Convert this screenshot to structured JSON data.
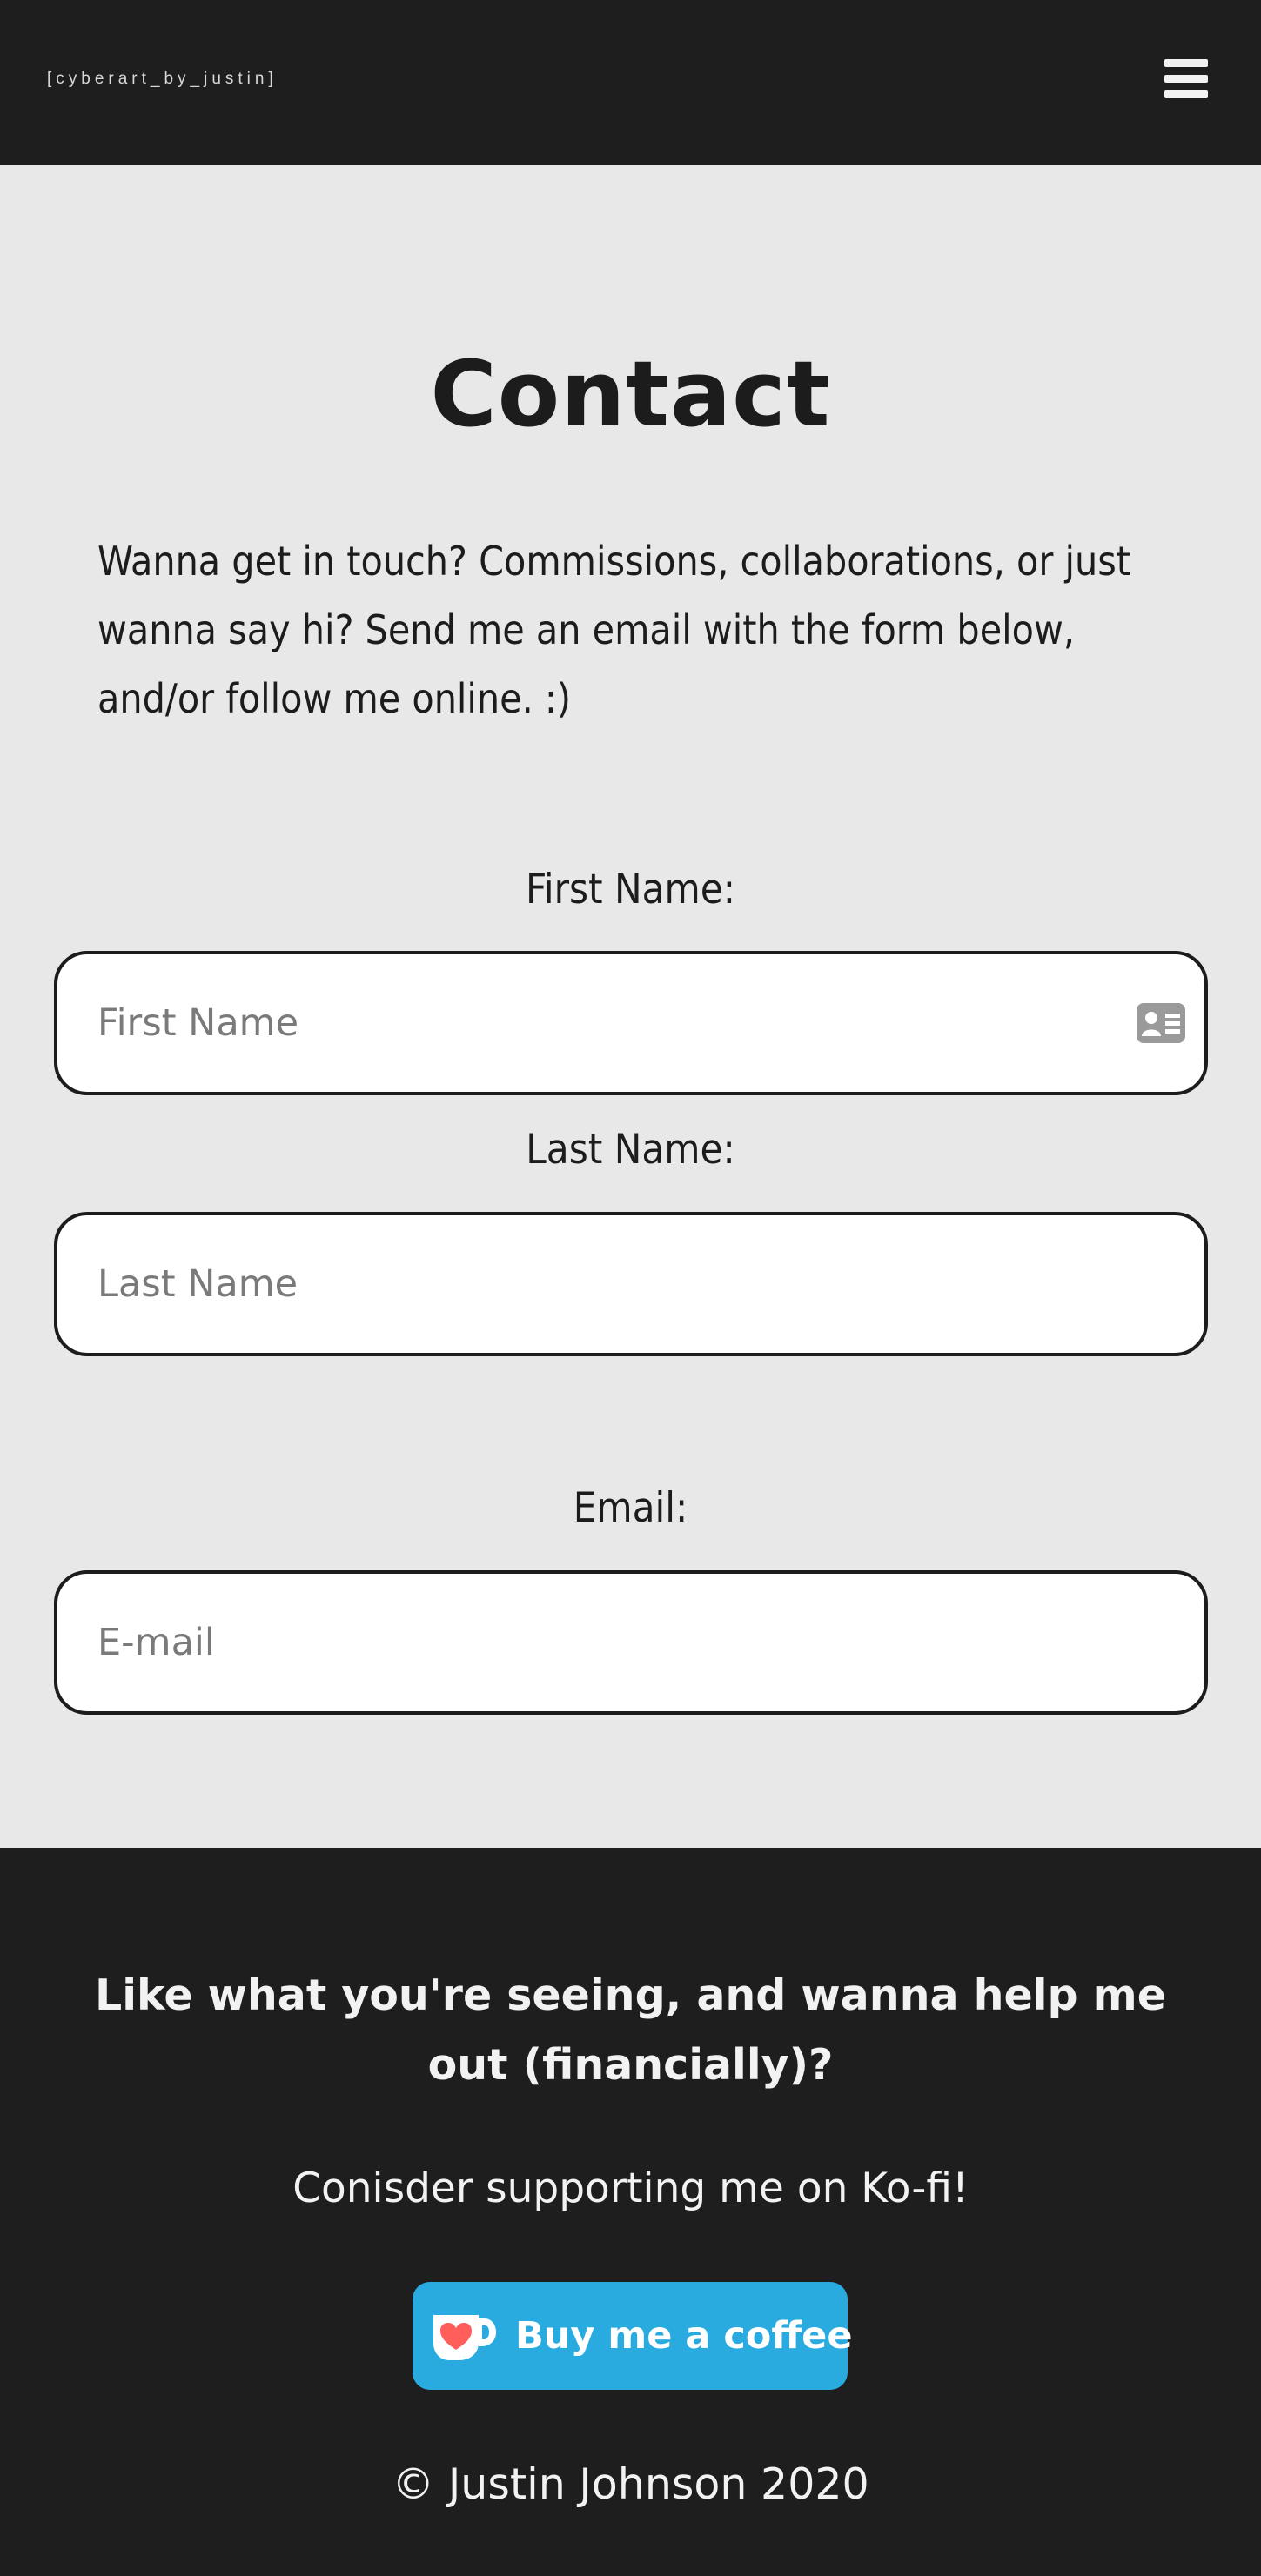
{
  "header": {
    "logo_text": "[cyberart_by_justin]",
    "menu_icon": "hamburger-menu-icon"
  },
  "main": {
    "title": "Contact",
    "intro": "Wanna get in touch? Commissions, collaborations, or just wanna say hi? Send me an email with the form below, and/or follow me online. :)",
    "form": {
      "first_name_label": "First Name:",
      "first_name_placeholder": "First Name",
      "first_name_value": "",
      "last_name_label": "Last Name:",
      "last_name_placeholder": "Last Name",
      "last_name_value": "",
      "email_label": "Email:",
      "email_placeholder": "E-mail",
      "email_value": "",
      "autofill_icon": "contact-card-icon"
    }
  },
  "footer": {
    "heading": "Like what you're seeing, and wanna help me out (financially)?",
    "subtext": "Conisder supporting me on Ko-fi!",
    "kofi_button_label": "Buy me a coffee",
    "kofi_icon": "kofi-cup-icon",
    "copyright": "© Justin Johnson 2020"
  },
  "colors": {
    "header_bg": "#1e1e1e",
    "page_bg": "#e8e8e8",
    "text_dark": "#1c1c1c",
    "text_light": "#f2f2f2",
    "placeholder": "#7a7a7a",
    "kofi_blue": "#29abe0",
    "kofi_heart": "#ff5e5b"
  }
}
